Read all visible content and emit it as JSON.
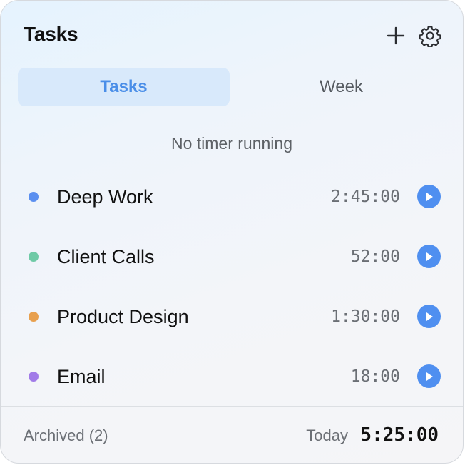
{
  "header": {
    "title": "Tasks",
    "add_icon": "plus-icon",
    "settings_icon": "gear-icon"
  },
  "tabs": [
    {
      "label": "Tasks",
      "selected": true
    },
    {
      "label": "Week",
      "selected": false
    }
  ],
  "timer": {
    "status": "No timer running"
  },
  "tasks": [
    {
      "name": "Deep Work",
      "time": "2:45:00",
      "color": "#5b8ff0",
      "action_icon": "play-icon"
    },
    {
      "name": "Client Calls",
      "time": "52:00",
      "color": "#6fcaa6",
      "action_icon": "play-icon"
    },
    {
      "name": "Product Design",
      "time": "1:30:00",
      "color": "#e8a04e",
      "action_icon": "play-icon"
    },
    {
      "name": "Email",
      "time": "18:00",
      "color": "#a17be8",
      "action_icon": "play-icon"
    }
  ],
  "footer": {
    "archived_label": "Archived (2)",
    "today_label": "Today",
    "today_total": "5:25:00"
  },
  "colors": {
    "accent": "#4f8ff0",
    "selected_tab_bg": "#d8e9fb"
  }
}
